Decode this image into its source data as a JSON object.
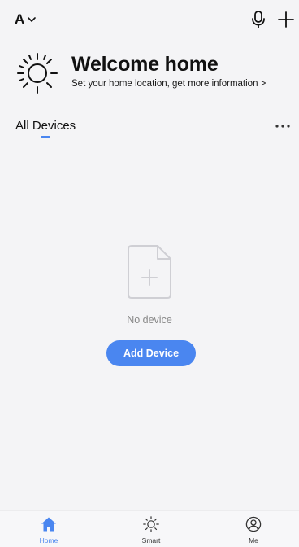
{
  "header": {
    "home_name": "A",
    "icons": [
      "chevron-down-icon",
      "microphone-icon",
      "plus-icon"
    ]
  },
  "welcome": {
    "title": "Welcome home",
    "subtitle": "Set your home location, get more information >",
    "icon": "sun-icon"
  },
  "devices": {
    "tab_label": "All Devices",
    "more_icon": "more-dots-icon"
  },
  "empty_state": {
    "icon": "document-add-icon",
    "message": "No device",
    "button_label": "Add Device"
  },
  "bottom_nav": {
    "items": [
      {
        "label": "Home",
        "icon": "home-icon",
        "active": true
      },
      {
        "label": "Smart",
        "icon": "sun-icon",
        "active": false
      },
      {
        "label": "Me",
        "icon": "user-icon",
        "active": false
      }
    ]
  },
  "colors": {
    "accent": "#4a86f0",
    "background": "#f4f4f6",
    "muted_text": "#888888"
  }
}
